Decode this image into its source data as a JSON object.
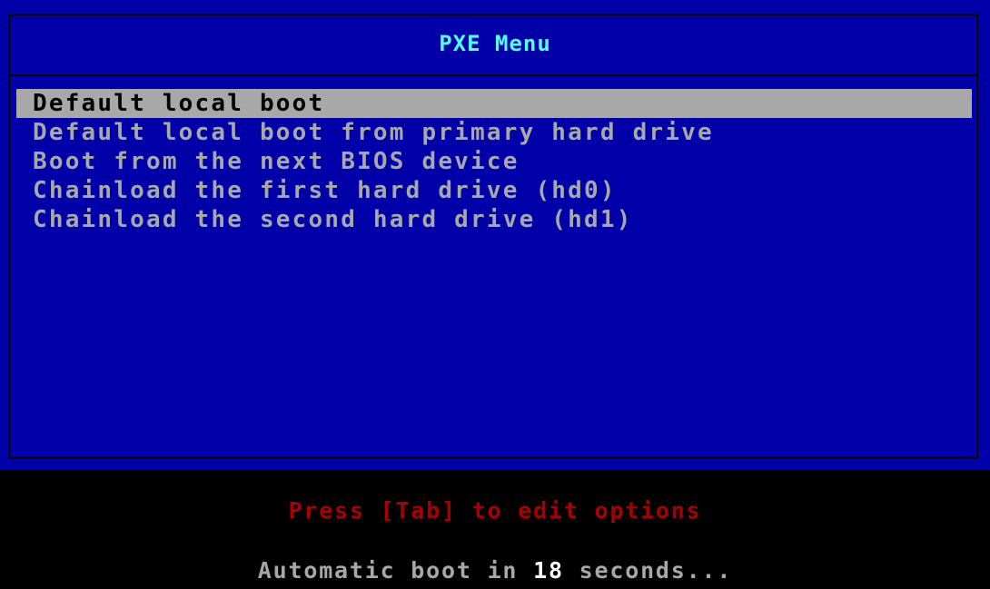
{
  "menu": {
    "title": "PXE Menu",
    "items": [
      {
        "label": "Default local boot",
        "selected": true
      },
      {
        "label": "Default local boot from primary hard drive",
        "selected": false
      },
      {
        "label": "Boot from the next BIOS device",
        "selected": false
      },
      {
        "label": "Chainload the first hard drive (hd0)",
        "selected": false
      },
      {
        "label": "Chainload the second hard drive (hd1)",
        "selected": false
      }
    ]
  },
  "footer": {
    "hint": "Press [Tab] to edit options",
    "countdown_prefix": "Automatic boot in ",
    "countdown_seconds": "18",
    "countdown_suffix": " seconds..."
  },
  "colors": {
    "background": "#000000",
    "menu_background": "#0000a8",
    "title": "#54fcfc",
    "item_text": "#a8a8a8",
    "selected_background": "#a8a8a8",
    "selected_text": "#000000",
    "hint_text": "#a80000",
    "countdown_text": "#a8a8a8",
    "countdown_number": "#ffffff"
  }
}
